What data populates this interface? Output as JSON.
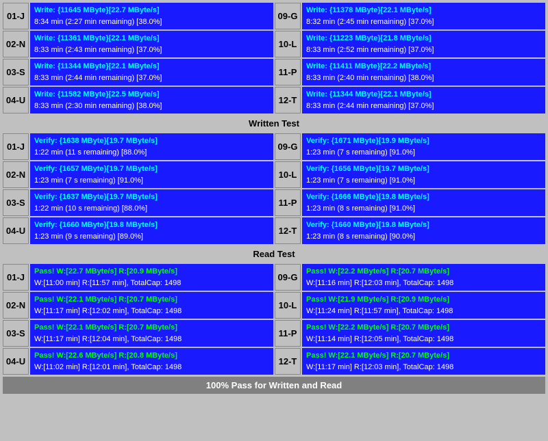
{
  "sections": {
    "write_test": {
      "label": "Written Test",
      "rows": [
        {
          "left_id": "01-J",
          "left_line1": "Write: {11645 MByte}[22.7 MByte/s]",
          "left_line2": "8:34 min (2:27 min remaining)  [38.0%]",
          "right_id": "09-G",
          "right_line1": "Write: {11378 MByte}[22.1 MByte/s]",
          "right_line2": "8:32 min (2:45 min remaining)  [37.0%]"
        },
        {
          "left_id": "02-N",
          "left_line1": "Write: {11361 MByte}[22.1 MByte/s]",
          "left_line2": "8:33 min (2:43 min remaining)  [37.0%]",
          "right_id": "10-L",
          "right_line1": "Write: {11223 MByte}[21.8 MByte/s]",
          "right_line2": "8:33 min (2:52 min remaining)  [37.0%]"
        },
        {
          "left_id": "03-S",
          "left_line1": "Write: {11344 MByte}[22.1 MByte/s]",
          "left_line2": "8:33 min (2:44 min remaining)  [37.0%]",
          "right_id": "11-P",
          "right_line1": "Write: {11411 MByte}[22.2 MByte/s]",
          "right_line2": "8:33 min (2:40 min remaining)  [38.0%]"
        },
        {
          "left_id": "04-U",
          "left_line1": "Write: {11582 MByte}[22.5 MByte/s]",
          "left_line2": "8:33 min (2:30 min remaining)  [38.0%]",
          "right_id": "12-T",
          "right_line1": "Write: {11344 MByte}[22.1 MByte/s]",
          "right_line2": "8:33 min (2:44 min remaining)  [37.0%]"
        }
      ]
    },
    "verify_test": {
      "label": "Written Test",
      "rows": [
        {
          "left_id": "01-J",
          "left_line1": "Verify: {1638 MByte}[19.7 MByte/s]",
          "left_line2": "1:22 min (11 s remaining)  [88.0%]",
          "right_id": "09-G",
          "right_line1": "Verify: {1671 MByte}[19.9 MByte/s]",
          "right_line2": "1:23 min (7 s remaining)  [91.0%]"
        },
        {
          "left_id": "02-N",
          "left_line1": "Verify: {1657 MByte}[19.7 MByte/s]",
          "left_line2": "1:23 min (7 s remaining)  [91.0%]",
          "right_id": "10-L",
          "right_line1": "Verify: {1656 MByte}[19.7 MByte/s]",
          "right_line2": "1:23 min (7 s remaining)  [91.0%]"
        },
        {
          "left_id": "03-S",
          "left_line1": "Verify: {1637 MByte}[19.7 MByte/s]",
          "left_line2": "1:22 min (10 s remaining)  [88.0%]",
          "right_id": "11-P",
          "right_line1": "Verify: {1666 MByte}[19.8 MByte/s]",
          "right_line2": "1:23 min (8 s remaining)  [91.0%]"
        },
        {
          "left_id": "04-U",
          "left_line1": "Verify: {1660 MByte}[19.8 MByte/s]",
          "left_line2": "1:23 min (9 s remaining)  [89.0%]",
          "right_id": "12-T",
          "right_line1": "Verify: {1660 MByte}[19.8 MByte/s]",
          "right_line2": "1:23 min (8 s remaining)  [90.0%]"
        }
      ]
    },
    "read_test": {
      "label": "Read Test",
      "rows": [
        {
          "left_id": "01-J",
          "left_line1": "Pass! W:[22.7 MByte/s] R:[20.9 MByte/s]",
          "left_line2": "W:[11:00 min] R:[11:57 min], TotalCap: 1498",
          "right_id": "09-G",
          "right_line1": "Pass! W:[22.2 MByte/s] R:[20.7 MByte/s]",
          "right_line2": "W:[11:16 min] R:[12:03 min], TotalCap: 1498"
        },
        {
          "left_id": "02-N",
          "left_line1": "Pass! W:[22.1 MByte/s] R:[20.7 MByte/s]",
          "left_line2": "W:[11:17 min] R:[12:02 min], TotalCap: 1498",
          "right_id": "10-L",
          "right_line1": "Pass! W:[21.9 MByte/s] R:[20.9 MByte/s]",
          "right_line2": "W:[11:24 min] R:[11:57 min], TotalCap: 1498"
        },
        {
          "left_id": "03-S",
          "left_line1": "Pass! W:[22.1 MByte/s] R:[20.7 MByte/s]",
          "left_line2": "W:[11:17 min] R:[12:04 min], TotalCap: 1498",
          "right_id": "11-P",
          "right_line1": "Pass! W:[22.2 MByte/s] R:[20.7 MByte/s]",
          "right_line2": "W:[11:14 min] R:[12:05 min], TotalCap: 1498"
        },
        {
          "left_id": "04-U",
          "left_line1": "Pass! W:[22.6 MByte/s] R:[20.8 MByte/s]",
          "left_line2": "W:[11:02 min] R:[12:01 min], TotalCap: 1498",
          "right_id": "12-T",
          "right_line1": "Pass! W:[22.1 MByte/s] R:[20.7 MByte/s]",
          "right_line2": "W:[11:17 min] R:[12:03 min], TotalCap: 1498"
        }
      ]
    }
  },
  "bottom_status": "100% Pass for Written and Read",
  "divider_write": "Written Test",
  "divider_read": "Read Test"
}
